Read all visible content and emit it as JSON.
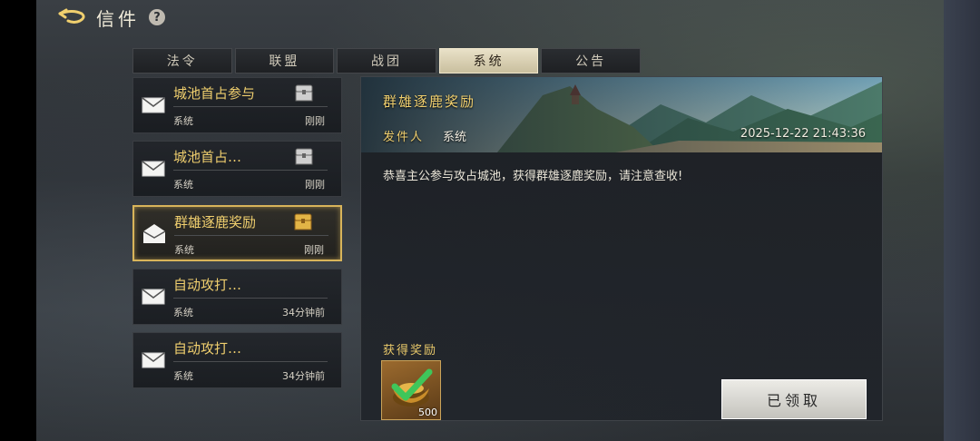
{
  "header": {
    "title": "信件",
    "help_glyph": "?"
  },
  "tabs": [
    "法令",
    "联盟",
    "战团",
    "系统",
    "公告"
  ],
  "active_tab": "系统",
  "mails": [
    {
      "subject": "城池首占参与",
      "sender": "系统",
      "time": "刚刚",
      "has_chest": true,
      "read": false,
      "selected": false
    },
    {
      "subject": "城池首占…",
      "sender": "系统",
      "time": "刚刚",
      "has_chest": true,
      "read": false,
      "selected": false
    },
    {
      "subject": "群雄逐鹿奖励",
      "sender": "系统",
      "time": "刚刚",
      "has_chest": true,
      "read": true,
      "selected": true
    },
    {
      "subject": "自动攻打…",
      "sender": "系统",
      "time": "34分钟前",
      "has_chest": false,
      "read": false,
      "selected": false
    },
    {
      "subject": "自动攻打…",
      "sender": "系统",
      "time": "34分钟前",
      "has_chest": false,
      "read": false,
      "selected": false
    }
  ],
  "detail": {
    "title": "群雄逐鹿奖励",
    "sender_label": "发件人",
    "sender": "系统",
    "timestamp": "2025-12-22 21:43:36",
    "body": "恭喜主公参与攻占城池，获得群雄逐鹿奖励，请注意查收!",
    "reward_label": "获得奖励",
    "reward": {
      "icon": "gold-ingot-icon",
      "count": "500",
      "claimed": true
    },
    "button_label": "已领取"
  },
  "colors": {
    "accent_gold": "#f0cf6e",
    "selected_border": "#d8b45a",
    "check_green": "#3fc65a"
  }
}
